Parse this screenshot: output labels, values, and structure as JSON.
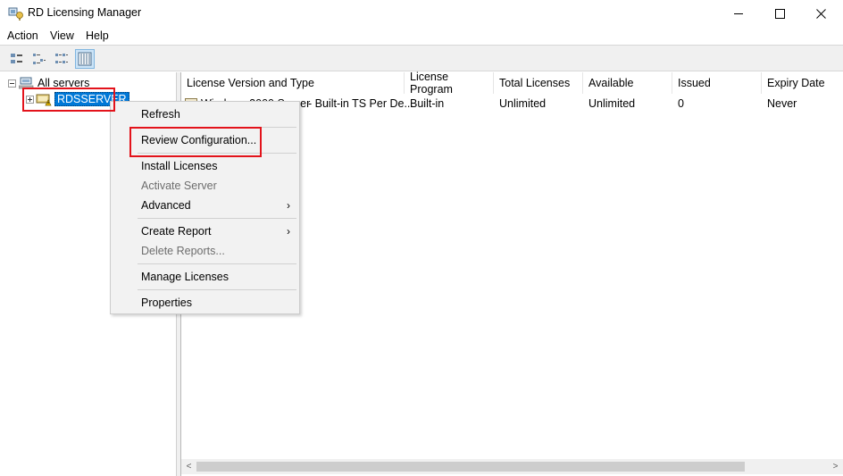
{
  "window": {
    "title": "RD Licensing Manager",
    "controls": {
      "minimize": "─",
      "maximize": "☐",
      "close": "✕"
    }
  },
  "menu": [
    "Action",
    "View",
    "Help"
  ],
  "toolbar": {
    "buttons": [
      "large-icons-view",
      "small-icons-view",
      "list-view",
      "details-view"
    ],
    "active": "details-view"
  },
  "tree": {
    "root_label": "All servers",
    "server_label": "RDSSERVER"
  },
  "list": {
    "columns": [
      "License Version and Type",
      "License Program",
      "Total Licenses",
      "Available",
      "Issued",
      "Expiry Date"
    ],
    "rows": [
      {
        "version_fragment_a": "Windows 2000 Server",
        "version_fragment_b": "- Built-in TS Per De...",
        "program": "Built-in",
        "total": "Unlimited",
        "available": "Unlimited",
        "issued": "0",
        "expiry": "Never"
      }
    ]
  },
  "context_menu": {
    "items": [
      {
        "label": "Refresh",
        "enabled": true
      },
      {
        "label": "Review Configuration...",
        "enabled": true
      },
      {
        "label": "Install Licenses",
        "enabled": true
      },
      {
        "label": "Activate Server",
        "enabled": false
      },
      {
        "label": "Advanced",
        "enabled": true,
        "submenu": "›"
      },
      {
        "label": "Create Report",
        "enabled": true,
        "submenu": "›"
      },
      {
        "label": "Delete Reports...",
        "enabled": false
      },
      {
        "label": "Manage Licenses",
        "enabled": true
      },
      {
        "label": "Properties",
        "enabled": true
      }
    ]
  },
  "scrollbar": {
    "left_arrow": "<",
    "right_arrow": ">"
  },
  "colors": {
    "selection": "#0078d7",
    "highlight_box": "#e3131b",
    "menu_bg": "#f2f2f2"
  }
}
